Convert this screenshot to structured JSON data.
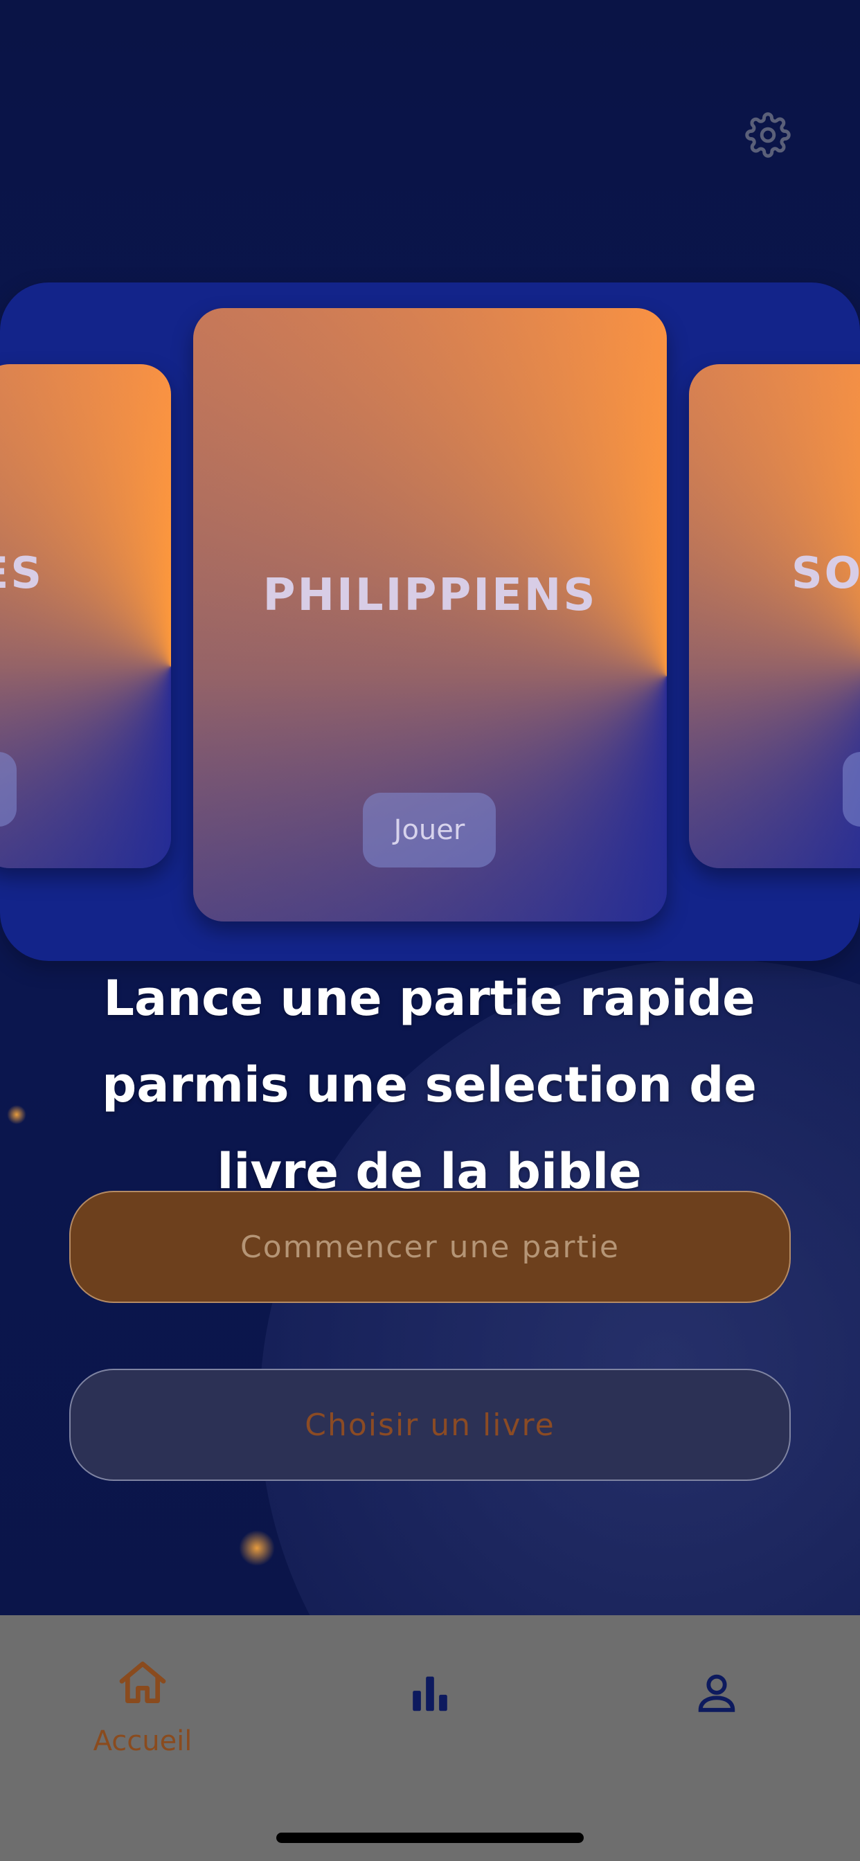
{
  "header": {
    "settings_icon": "gear-icon"
  },
  "carousel": {
    "cards": [
      {
        "title": "ES",
        "play_label": ""
      },
      {
        "title": "PHILIPPIENS",
        "play_label": "Jouer"
      },
      {
        "title": "SOF",
        "play_label": ""
      }
    ]
  },
  "main": {
    "headline_lines": [
      "Lance une partie rapide",
      "parmis une selection de",
      "livre de la bible"
    ],
    "start_button_label": "Commencer une partie",
    "choose_book_button_label": "Choisir un livre"
  },
  "tabbar": {
    "items": [
      {
        "icon": "home-icon",
        "label": "Accueil",
        "active": true
      },
      {
        "icon": "stats-icon",
        "label": "",
        "active": false
      },
      {
        "icon": "profile-icon",
        "label": "",
        "active": false
      }
    ]
  },
  "colors": {
    "background": "#0b1548",
    "panel": "#13248a",
    "accent": "#8a4b1e",
    "primary_button": "#6d401d",
    "tabbar": "#6e6e6e",
    "tab_inactive": "#0d1a5e"
  }
}
